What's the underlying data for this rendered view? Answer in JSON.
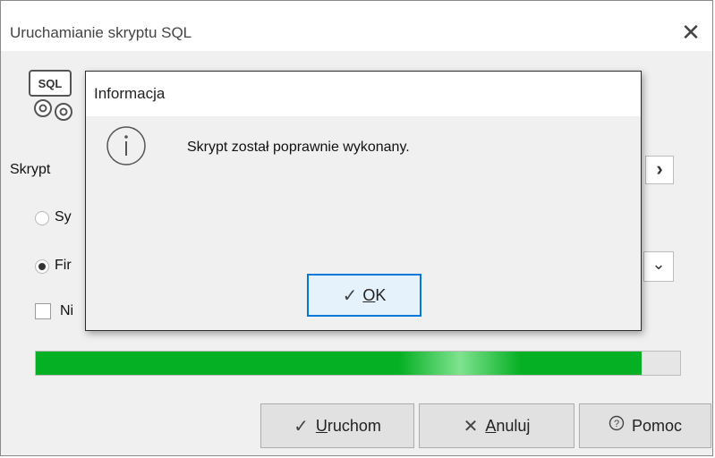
{
  "window": {
    "title": "Uruchamianie skryptu SQL",
    "close_glyph": "✕"
  },
  "sql_icon": {
    "text": "SQL"
  },
  "form": {
    "script_label": "Skrypt",
    "radio_system_label": "Sy",
    "radio_firm_label": "Fir",
    "checkbox_label": "Ni",
    "arrow_glyph": "›",
    "dropdown_glyph": "⌄"
  },
  "progress": {
    "value_percent": 94,
    "color": "#06b025"
  },
  "buttons": {
    "run": {
      "icon": "✓",
      "label_u": "U",
      "label_rest": "ruchom"
    },
    "cancel": {
      "icon": "✕",
      "label_u": "A",
      "label_rest": "nuluj"
    },
    "help": {
      "icon": "⍰",
      "label": "Pomoc"
    }
  },
  "dialog": {
    "title": "Informacja",
    "message": "Skrypt został poprawnie wykonany.",
    "ok": {
      "icon": "✓",
      "label_u": "O",
      "label_rest": "K"
    }
  }
}
